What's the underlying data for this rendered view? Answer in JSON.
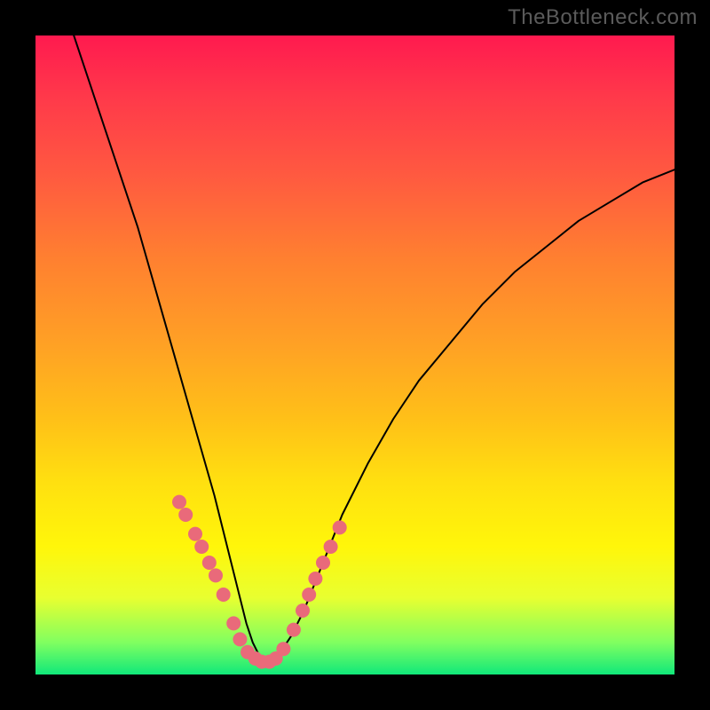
{
  "watermark": "TheBottleneck.com",
  "chart_data": {
    "type": "line",
    "title": "",
    "xlabel": "",
    "ylabel": "",
    "xlim": [
      0,
      100
    ],
    "ylim": [
      0,
      100
    ],
    "grid": false,
    "series": [
      {
        "name": "bottleneck-curve",
        "x": [
          6,
          8,
          10,
          12,
          14,
          16,
          18,
          20,
          22,
          24,
          26,
          28,
          30,
          32,
          33,
          34,
          35,
          36,
          37,
          38,
          40,
          42,
          44,
          46,
          48,
          52,
          56,
          60,
          65,
          70,
          75,
          80,
          85,
          90,
          95,
          100
        ],
        "y": [
          100,
          94,
          88,
          82,
          76,
          70,
          63,
          56,
          49,
          42,
          35,
          28,
          20,
          12,
          8,
          5,
          3,
          2,
          2,
          3,
          6,
          10,
          15,
          20,
          25,
          33,
          40,
          46,
          52,
          58,
          63,
          67,
          71,
          74,
          77,
          79
        ]
      }
    ],
    "overlay_markers": {
      "name": "highlight-dots",
      "color": "#e96a7a",
      "points_x": [
        22.5,
        23.5,
        25,
        26,
        27.2,
        28.2,
        29.4,
        31,
        32,
        33.2,
        34.4,
        35.4,
        36.6,
        37.6,
        38.8,
        40.4,
        41.8,
        42.8,
        43.8,
        45,
        46.2,
        47.6
      ],
      "points_y": [
        27,
        25,
        22,
        20,
        17.5,
        15.5,
        12.5,
        8,
        5.5,
        3.5,
        2.5,
        2,
        2,
        2.5,
        4,
        7,
        10,
        12.5,
        15,
        17.5,
        20,
        23
      ]
    }
  }
}
